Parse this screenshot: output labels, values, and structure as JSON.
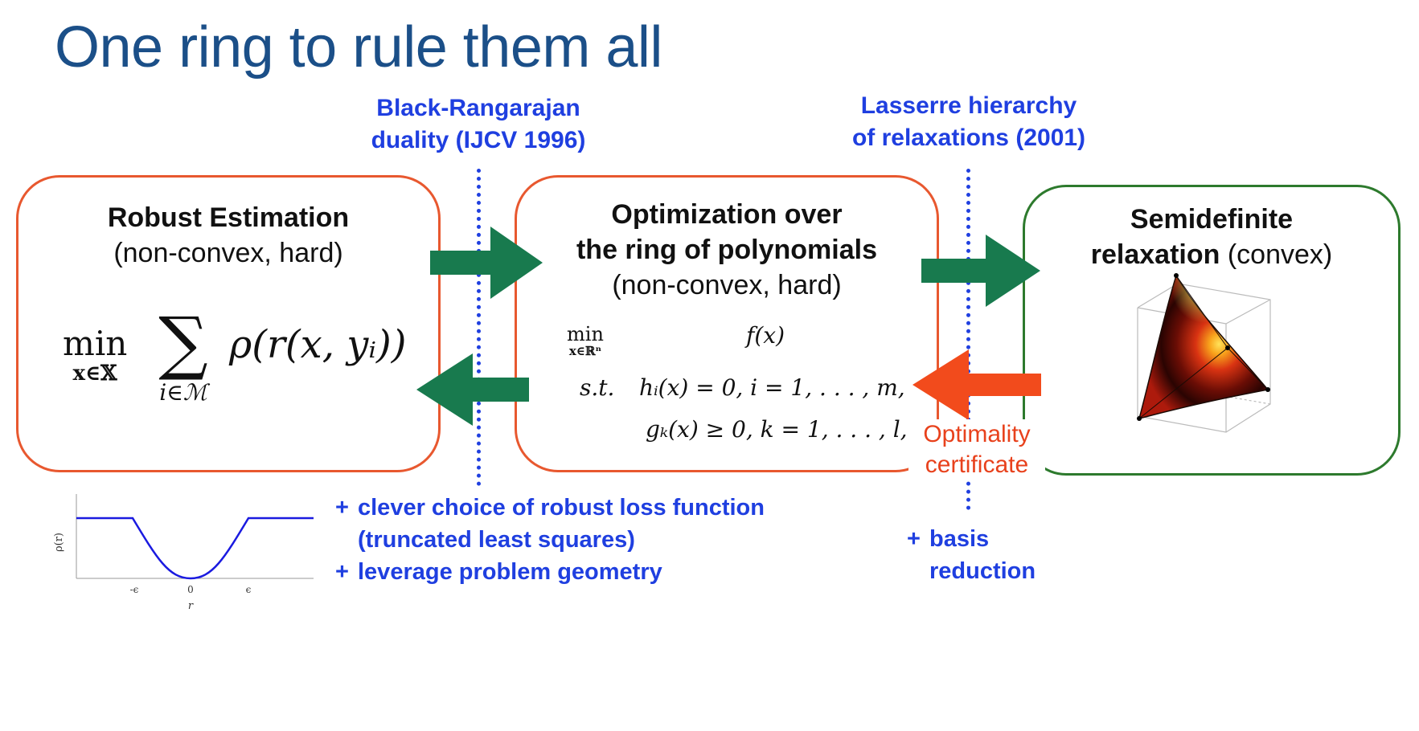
{
  "title": "One ring to rule them all",
  "notes": {
    "black_rangarajan_line1": "Black-Rangarajan",
    "black_rangarajan_line2": "duality (IJCV 1996)",
    "lasserre_line1": "Lasserre hierarchy",
    "lasserre_line2": "of relaxations (2001)"
  },
  "boxes": {
    "robust": {
      "title": "Robust Estimation",
      "subtitle": "(non-convex, hard)",
      "formula_min": "min",
      "formula_min_sub": "x∈𝕏",
      "formula_sum_sub": "i∈ℳ",
      "formula_body": "ρ(r(x, yᵢ))"
    },
    "polynomial": {
      "title_line1": "Optimization over",
      "title_line2": "the ring of polynomials",
      "subtitle": "(non-convex, hard)",
      "min": "min",
      "min_sub": "x∈ℝⁿ",
      "objective": "f(x)",
      "st": "s.t.",
      "constraint1": "hᵢ(x) = 0, i = 1, . . . , m,",
      "constraint2": "gₖ(x) ≥ 0, k = 1, . . . , l,"
    },
    "sdp": {
      "title_bold_line1": "Semidefinite",
      "title_bold_line2": "relaxation",
      "title_normal": "(convex)"
    }
  },
  "certificate": {
    "line1": "Optimality",
    "line2": "certificate"
  },
  "bottom_notes": {
    "left_items": [
      {
        "plus": "+",
        "text": "clever choice of robust loss function"
      },
      {
        "plus": "",
        "text": "(truncated least squares)"
      },
      {
        "plus": "+",
        "text": "leverage problem geometry"
      }
    ],
    "right_items": [
      {
        "plus": "+",
        "text": "basis"
      },
      {
        "plus": "",
        "text": "reduction"
      }
    ]
  },
  "loss_plot": {
    "ylabel": "ρ(r)",
    "xlabel": "r",
    "ticks": [
      "-ϵ",
      "0",
      "ϵ"
    ]
  },
  "colors": {
    "title": "#1b4f88",
    "note_blue": "#1f3fe0",
    "box_red": "#e8582f",
    "box_green": "#2d7a2d",
    "arrow_green": "#187a4e",
    "arrow_red": "#f24b1c"
  }
}
